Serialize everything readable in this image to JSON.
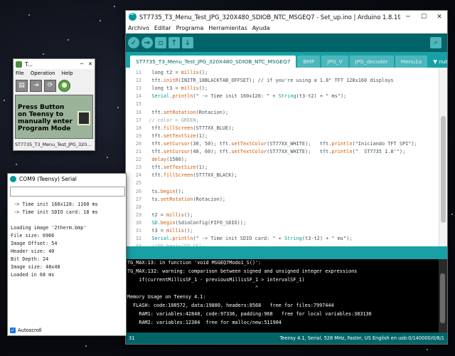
{
  "ide": {
    "title": "ST7735_T3_Menu_Test_JPG_320X480_SDIOB_NTC_MSGEQ7 - Set_up.ino | Arduino 1.8.19",
    "menu": [
      "Archivo",
      "Editar",
      "Programa",
      "Herramientas",
      "Ayuda"
    ],
    "toolbar": {
      "verify_icon": "checkmark-icon",
      "upload_icon": "arrow-right-icon",
      "new_icon": "new-file-icon",
      "open_icon": "arrow-up-icon",
      "save_icon": "arrow-down-icon",
      "serial_icon": "magnifier-icon"
    },
    "tabs": [
      "ST7735_T3_Menu_Test_JPG_320X480_SDIOB_NTC_MSGEQ7",
      "BMP",
      "JPG_V",
      "JPG_decoder",
      "Menu1a"
    ],
    "tabs_menu": "▼ nuth",
    "code_lines": [
      {
        "n": "11",
        "parts": [
          {
            "t": "  long t2 = "
          },
          {
            "t": "millis",
            "c": "fn"
          },
          {
            "t": "();"
          }
        ]
      },
      {
        "n": "12",
        "parts": [
          {
            "t": "  tft."
          },
          {
            "t": "initR",
            "c": "fn"
          },
          {
            "t": "(INITR_18BLACKTAB_OFFSET); // if you're using a 1.8\" TFT 128x160 displays"
          }
        ]
      },
      {
        "n": "13",
        "parts": [
          {
            "t": "  long t3 = "
          },
          {
            "t": "millis",
            "c": "fn"
          },
          {
            "t": "();"
          }
        ]
      },
      {
        "n": "14",
        "parts": [
          {
            "t": "  "
          },
          {
            "t": "Serial",
            "c": "kw"
          },
          {
            "t": "."
          },
          {
            "t": "println",
            "c": "fn"
          },
          {
            "t": "(\" -> Time init 160x128: \" + "
          },
          {
            "t": "String",
            "c": "kw"
          },
          {
            "t": "(t3-t2) + \" ms\");"
          }
        ]
      },
      {
        "n": "15",
        "parts": [
          {
            "t": ""
          }
        ]
      },
      {
        "n": "16",
        "parts": [
          {
            "t": "  tft."
          },
          {
            "t": "setRotation",
            "c": "fn"
          },
          {
            "t": "(Rotacion);"
          }
        ]
      },
      {
        "n": "17",
        "parts": [
          {
            "t": " // color = GREEN;",
            "c": "com"
          }
        ]
      },
      {
        "n": "18",
        "parts": [
          {
            "t": "  tft."
          },
          {
            "t": "fillScreen",
            "c": "fn"
          },
          {
            "t": "(ST77XX_BLUE);"
          }
        ]
      },
      {
        "n": "19",
        "parts": [
          {
            "t": "  tft."
          },
          {
            "t": "setTextSize",
            "c": "fn"
          },
          {
            "t": "(1);"
          }
        ]
      },
      {
        "n": "20",
        "parts": [
          {
            "t": "  tft."
          },
          {
            "t": "setCursor",
            "c": "fn"
          },
          {
            "t": "(30, 50); tft."
          },
          {
            "t": "setTextColor",
            "c": "fn"
          },
          {
            "t": "(ST77XX_WHITE);   tft."
          },
          {
            "t": "println",
            "c": "fn"
          },
          {
            "t": "(\"Iniciando TFT SPI\");"
          }
        ]
      },
      {
        "n": "21",
        "parts": [
          {
            "t": "  tft."
          },
          {
            "t": "setCursor",
            "c": "fn"
          },
          {
            "t": "(40, 60); tft."
          },
          {
            "t": "setTextColor",
            "c": "fn"
          },
          {
            "t": "(ST77XX_WHITE);   tft."
          },
          {
            "t": "println",
            "c": "fn"
          },
          {
            "t": "(\"  ST7735 1.8'\");"
          }
        ]
      },
      {
        "n": "22",
        "parts": [
          {
            "t": "  "
          },
          {
            "t": "delay",
            "c": "fn"
          },
          {
            "t": "(1500);"
          }
        ]
      },
      {
        "n": "23",
        "parts": [
          {
            "t": "  tft."
          },
          {
            "t": "setTextSize",
            "c": "fn"
          },
          {
            "t": "(1);"
          }
        ]
      },
      {
        "n": "24",
        "parts": [
          {
            "t": "  tft."
          },
          {
            "t": "fillScreen",
            "c": "fn"
          },
          {
            "t": "(ST77XX_BLACK);"
          }
        ]
      },
      {
        "n": "25",
        "parts": [
          {
            "t": ""
          }
        ]
      },
      {
        "n": "26",
        "parts": [
          {
            "t": "  ts."
          },
          {
            "t": "begin",
            "c": "fn"
          },
          {
            "t": "();"
          }
        ]
      },
      {
        "n": "27",
        "parts": [
          {
            "t": "  ts."
          },
          {
            "t": "setRotation",
            "c": "fn"
          },
          {
            "t": "(Rotacion);"
          }
        ]
      },
      {
        "n": "28",
        "parts": [
          {
            "t": ""
          }
        ]
      },
      {
        "n": "29",
        "parts": [
          {
            "t": "  t2 = "
          },
          {
            "t": "millis",
            "c": "fn"
          },
          {
            "t": "();"
          }
        ]
      },
      {
        "n": "30",
        "parts": [
          {
            "t": "  "
          },
          {
            "t": "SD",
            "c": "kw"
          },
          {
            "t": "."
          },
          {
            "t": "begin",
            "c": "fn"
          },
          {
            "t": "(SdioConfig(FIFO_SDIO));"
          }
        ]
      },
      {
        "n": "31",
        "parts": [
          {
            "t": "  t3 = "
          },
          {
            "t": "millis",
            "c": "fn"
          },
          {
            "t": "();"
          }
        ]
      },
      {
        "n": "32",
        "parts": [
          {
            "t": "  "
          },
          {
            "t": "Serial",
            "c": "kw"
          },
          {
            "t": "."
          },
          {
            "t": "println",
            "c": "fn"
          },
          {
            "t": "(\" -> Time init SDIO card: \" + "
          },
          {
            "t": "String",
            "c": "kw"
          },
          {
            "t": "(t3-t2) + \" ms\");"
          }
        ]
      },
      {
        "n": "33",
        "parts": [
          {
            "t": "  //SD.begin(SD_CS);",
            "c": "com"
          }
        ]
      }
    ],
    "console_lines": [
      "TG_MAX:13: in function 'void MSGEQ7Modo1_S()':",
      "TG_MAX:132: warning: comparison between signed and unsigned integer expressions",
      "    if(currentMillisSF_1 - previousMillisSF_1 > intervalSF_1)",
      "                                            ^",
      "Memory Usage on Teensy 4.1:",
      "  FLASH: code:100572, data:19880, headers:8568   free for files:7997444",
      "    RAM1: variables:42848, code:97336, padding:968   free for local variables:383136",
      "    RAM2: variables:12384  free for malloc/new:511904"
    ],
    "footer": {
      "line": "31",
      "board": "Teensy 4.1, Serial, 528 MHz, Faster, US English en usb:0/140000/0/8/1"
    }
  },
  "teensy": {
    "title": "T...",
    "menu": [
      "File",
      "Operation",
      "Help"
    ],
    "message": "Press Button on Teensy to manually enter Program Mode",
    "status": "ST7735_T3_Menu_Test_JPG_320..."
  },
  "serial": {
    "title": "COM9 (Teensy) Serial",
    "lines": [
      " -> Time init 160x128: 1160 ms",
      " -> Time init SDIO card: 18 ms",
      "",
      "Loading image '2therm.bmp'",
      "File size: 6966",
      "Image Offset: 54",
      "Header size: 40",
      "Bit Depth: 24",
      "Image size: 48x48",
      "Loaded in 68 ms"
    ],
    "autoscroll_label": "Autoscroll"
  },
  "colors": {
    "arduino_dark": "#006468",
    "arduino_teal": "#17a1a5",
    "arduino_light": "#4db7bb",
    "code_function": "#d35400",
    "code_keyword": "#00979c"
  }
}
